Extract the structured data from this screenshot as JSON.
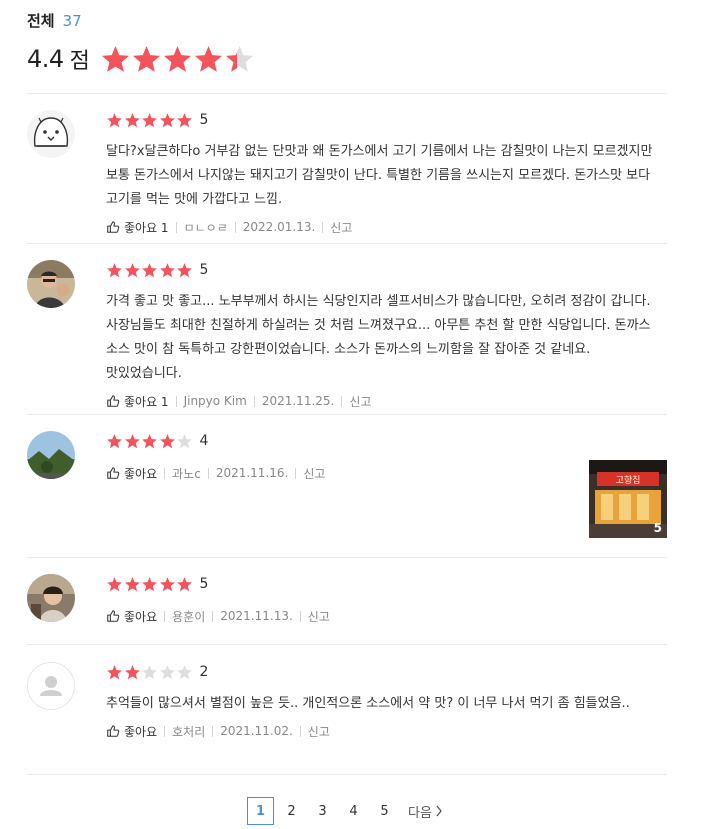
{
  "summary": {
    "total_label": "전체",
    "total_count": "37",
    "score": "4.4",
    "score_unit": "점",
    "rating": 4.4
  },
  "colors": {
    "star_filled": "#f5535b",
    "star_empty": "#dddddd",
    "accent": "#4a90d9"
  },
  "reviews": [
    {
      "rating": 5,
      "rating_text": "5",
      "text": "달다?x달큰하다o 거부감 없는 단맛과 왜 돈가스에서 고기 기름에서 나는 감칠맛이 나는지 모르겠지만 보통 돈가스에서 나지않는 돼지고기 감칠맛이 난다. 특별한 기름을 쓰시는지 모르겠다. 돈가스맛 보다 고기를 먹는 맛에 가깝다고 느낌.",
      "likes_label": "좋아요 1",
      "author": "ㅁㄴㅇㄹ",
      "date": "2022.01.13.",
      "report": "신고",
      "avatar": "cartoon-avatar"
    },
    {
      "rating": 5,
      "rating_text": "5",
      "text": "가격 좋고 맛 좋고... 노부부께서 하시는 식당인지라 셀프서비스가 많습니다만, 오히려 정감이 갑니다. 사장님들도 최대한 친절하게 하실려는 것 처럼 느껴졌구요... 아무튼 추천 할 만한 식당입니다. 돈까스 소스 맛이 참 독특하고 강한편이었습니다. 소스가 돈까스의 느끼함을 잘 잡아준 것 같네요. 맛있었습니다.",
      "likes_label": "좋아요 1",
      "author": "Jinpyo Kim",
      "date": "2021.11.25.",
      "report": "신고",
      "avatar": "photo-avatar"
    },
    {
      "rating": 4,
      "rating_text": "4",
      "text": "",
      "likes_label": "좋아요",
      "author": "과노c",
      "date": "2021.11.16.",
      "report": "신고",
      "avatar": "landscape-avatar",
      "photo_count": "5",
      "photo_sign": "고향집"
    },
    {
      "rating": 5,
      "rating_text": "5",
      "text": "",
      "likes_label": "좋아요",
      "author": "용훈이",
      "date": "2021.11.13.",
      "report": "신고",
      "avatar": "child-avatar"
    },
    {
      "rating": 2,
      "rating_text": "2",
      "text": "추억들이 많으셔서 별점이 높은 듯.. 개인적으론 소스에서 약 맛? 이 너무 나서 먹기 좀 힘들었음..",
      "likes_label": "좋아요",
      "author": "호처리",
      "date": "2021.11.02.",
      "report": "신고",
      "avatar": "default-avatar"
    }
  ],
  "pagination": {
    "pages": [
      "1",
      "2",
      "3",
      "4",
      "5"
    ],
    "current": "1",
    "next_label": "다음"
  }
}
